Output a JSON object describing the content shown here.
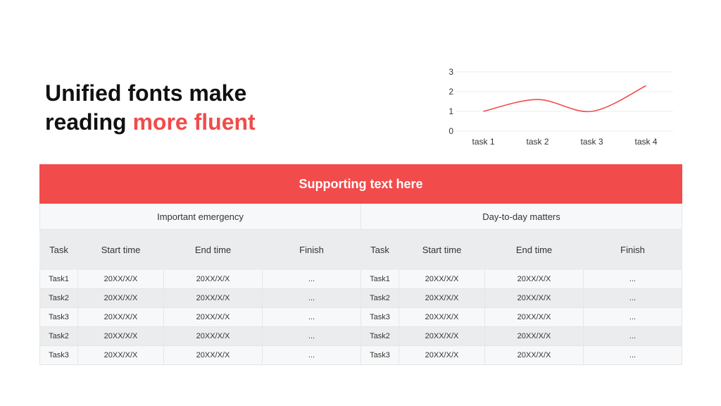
{
  "heading": {
    "line1": "Unified fonts make",
    "line2_plain": "reading",
    "line2_accent": "more fluent"
  },
  "colors": {
    "accent": "#f24b4b",
    "header_bg": "#ebecee",
    "row_light": "#f7f8f9"
  },
  "chart_data": {
    "type": "line",
    "categories": [
      "task 1",
      "task 2",
      "task 3",
      "task 4"
    ],
    "series": [
      {
        "values": [
          1,
          1.6,
          1,
          2.3
        ],
        "color": "#f24b4b"
      }
    ],
    "yticks": [
      "0",
      "1",
      "2",
      "3"
    ],
    "ylim": [
      0,
      3
    ],
    "smooth": true,
    "grid": true,
    "legend": "none",
    "title": "",
    "xlabel": "",
    "ylabel": ""
  },
  "table": {
    "banner": "Supporting text here",
    "groups": [
      "Important emergency",
      "Day-to-day matters"
    ],
    "columns": [
      "Task",
      "Start time",
      "End time",
      "Finish"
    ],
    "left_rows": [
      [
        "Task1",
        "20XX/X/X",
        "20XX/X/X",
        "..."
      ],
      [
        "Task2",
        "20XX/X/X",
        "20XX/X/X",
        "..."
      ],
      [
        "Task3",
        "20XX/X/X",
        "20XX/X/X",
        "..."
      ],
      [
        "Task2",
        "20XX/X/X",
        "20XX/X/X",
        "..."
      ],
      [
        "Task3",
        "20XX/X/X",
        "20XX/X/X",
        "..."
      ]
    ],
    "right_rows": [
      [
        "Task1",
        "20XX/X/X",
        "20XX/X/X",
        "..."
      ],
      [
        "Task2",
        "20XX/X/X",
        "20XX/X/X",
        "..."
      ],
      [
        "Task3",
        "20XX/X/X",
        "20XX/X/X",
        "..."
      ],
      [
        "Task2",
        "20XX/X/X",
        "20XX/X/X",
        "..."
      ],
      [
        "Task3",
        "20XX/X/X",
        "20XX/X/X",
        "..."
      ]
    ]
  }
}
